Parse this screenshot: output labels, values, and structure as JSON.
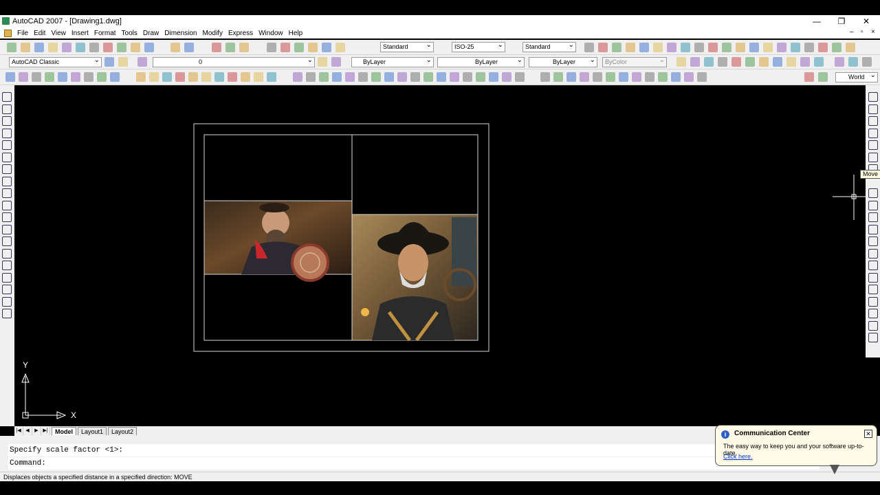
{
  "window": {
    "title": "AutoCAD 2007 - [Drawing1.dwg]",
    "controls": [
      "—",
      "❐",
      "✕"
    ],
    "doc_controls": [
      "–",
      "▫",
      "×"
    ]
  },
  "menu": [
    "File",
    "Edit",
    "View",
    "Insert",
    "Format",
    "Tools",
    "Draw",
    "Dimension",
    "Modify",
    "Express",
    "Window",
    "Help"
  ],
  "toolbar_standard": {
    "text_style": "Standard",
    "dim_style": "ISO-25",
    "table_style": "Standard"
  },
  "toolbar_layers": {
    "workspace": "AutoCAD Classic",
    "layer": "0",
    "color": "ByLayer",
    "linetype": "ByLayer",
    "lineweight": "ByLayer",
    "plotstyle": "ByColor"
  },
  "toolbar_3d": {
    "view": "World"
  },
  "canvas": {
    "ucs_y": "Y",
    "ucs_x": "X"
  },
  "tooltip": "Move",
  "tabs": {
    "nav": [
      "|◀",
      "◀",
      "▶",
      "▶|"
    ],
    "items": [
      "Model",
      "Layout1",
      "Layout2"
    ],
    "active": "Model"
  },
  "command": {
    "history": "Specify scale factor <1>:",
    "prompt": "Command:"
  },
  "status": "Displaces objects a specified distance in a specified direction:  MOVE",
  "balloon": {
    "title": "Communication Center",
    "text": "The easy way to keep you and your software up-to-date.",
    "link": "Click here.",
    "close": "✕",
    "info": "i"
  },
  "colors": {
    "accent": "#2b5fc7",
    "canvas": "#000000"
  }
}
